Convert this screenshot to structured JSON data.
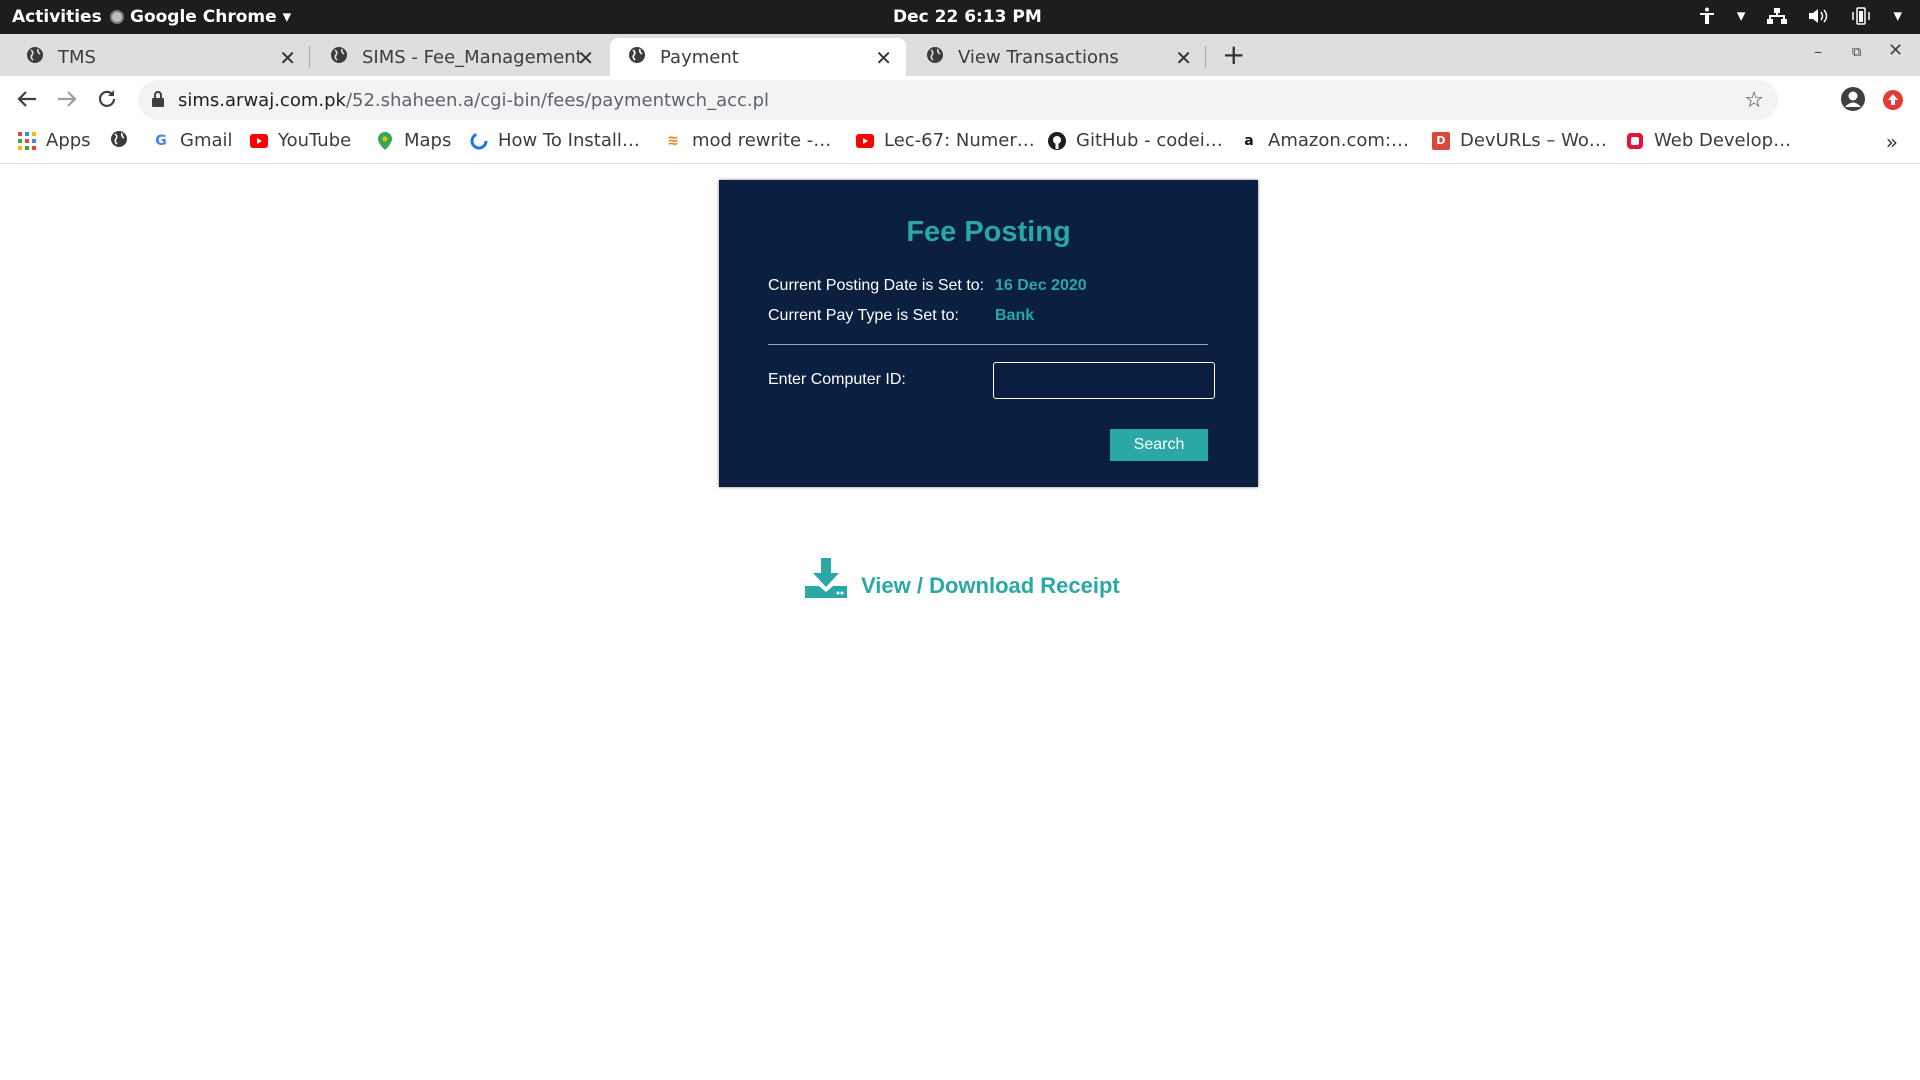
{
  "system": {
    "activities": "Activities",
    "app_menu": "Google Chrome",
    "clock": "Dec 22   6:13 PM"
  },
  "tabs": [
    {
      "title": "TMS",
      "active": false
    },
    {
      "title": "SIMS - Fee_Management",
      "active": false
    },
    {
      "title": "Payment",
      "active": true
    },
    {
      "title": "View Transactions",
      "active": false
    }
  ],
  "address_bar": {
    "domain": "sims.arwaj.com.pk",
    "path": "/52.shaheen.a/cgi-bin/fees/paymentwch_acc.pl"
  },
  "bookmarks": [
    {
      "label": "Apps",
      "icon": "apps-grid-icon"
    },
    {
      "label": "",
      "icon": "globe-icon"
    },
    {
      "label": "Gmail",
      "icon": "google-icon"
    },
    {
      "label": "YouTube",
      "icon": "youtube-icon"
    },
    {
      "label": "Maps",
      "icon": "maps-icon"
    },
    {
      "label": "How To Install…",
      "icon": "loader-icon"
    },
    {
      "label": "mod rewrite -…",
      "icon": "stackoverflow-icon"
    },
    {
      "label": "Lec-67: Numer…",
      "icon": "youtube-icon"
    },
    {
      "label": "GitHub - codei…",
      "icon": "github-icon"
    },
    {
      "label": "Amazon.com:…",
      "icon": "amazon-icon"
    },
    {
      "label": "DevURLs – Wo…",
      "icon": "devurls-icon"
    },
    {
      "label": "Web Develop…",
      "icon": "web-develop-icon"
    }
  ],
  "page": {
    "title": "Fee Posting",
    "posting_date_label": "Current Posting Date is Set to:",
    "posting_date_value": "16 Dec 2020",
    "pay_type_label": "Current Pay Type is Set to:",
    "pay_type_value": "Bank",
    "computer_id_label": "Enter Computer ID:",
    "computer_id_value": "",
    "search_button": "Search",
    "receipt_link": "View / Download Receipt"
  },
  "colors": {
    "panel_bg": "#0b1f40",
    "accent": "#2aa8a5"
  }
}
